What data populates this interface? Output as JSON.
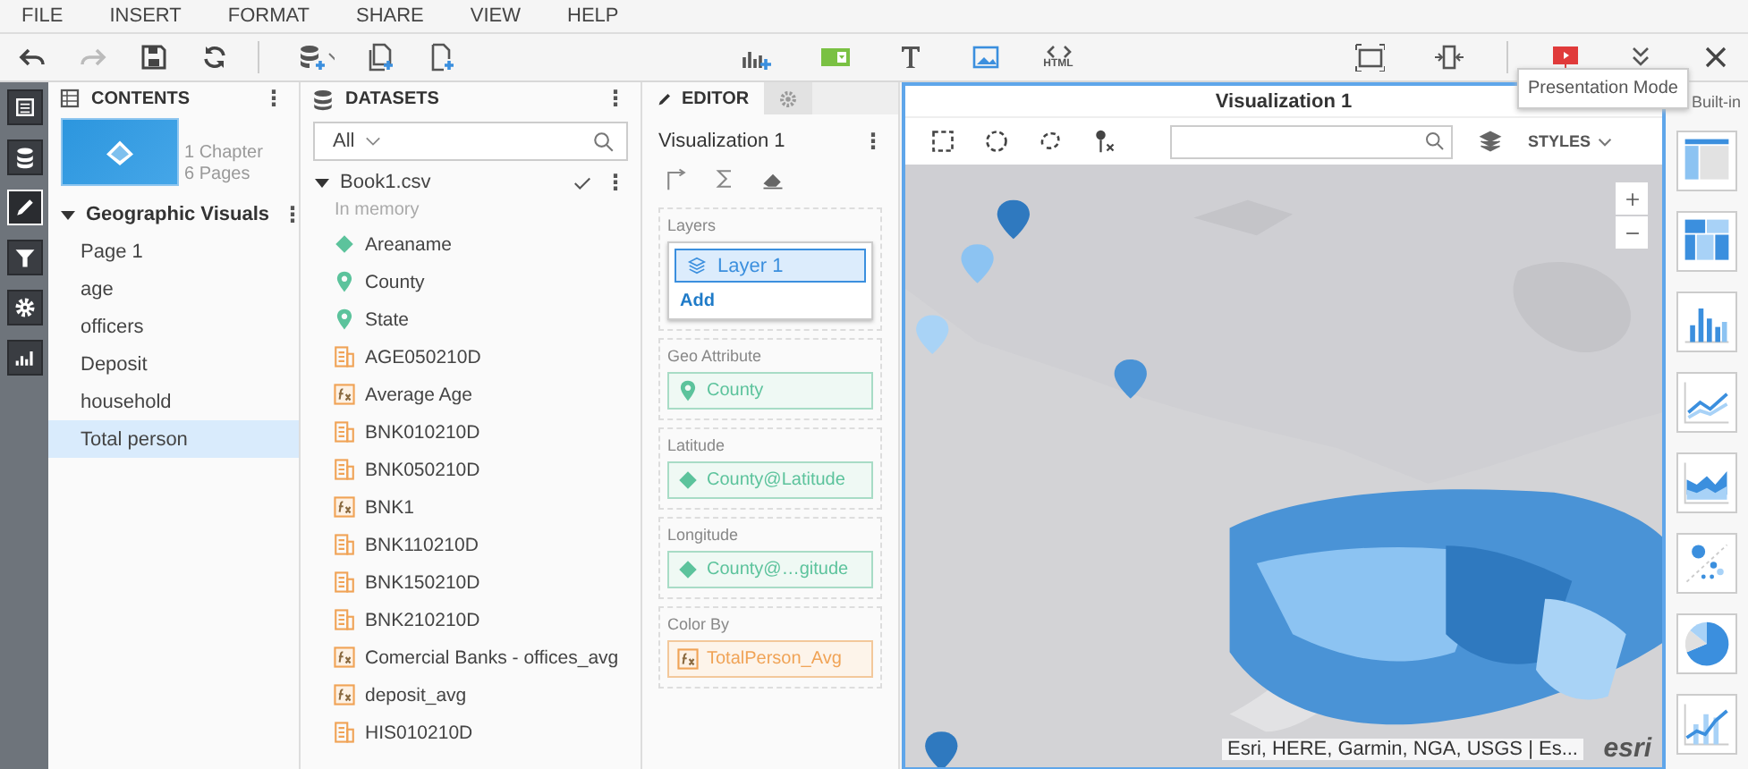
{
  "menu": [
    "FILE",
    "INSERT",
    "FORMAT",
    "SHARE",
    "VIEW",
    "HELP"
  ],
  "toolbar": {
    "html_label": "HTML",
    "tooltip": "Presentation Mode"
  },
  "rail": [
    {
      "kind": "contents",
      "selected": false
    },
    {
      "kind": "datasets",
      "selected": false
    },
    {
      "kind": "editor",
      "selected": true
    },
    {
      "kind": "filter",
      "selected": false
    },
    {
      "kind": "settings",
      "selected": false
    },
    {
      "kind": "charts",
      "selected": false
    }
  ],
  "contents": {
    "title": "CONTENTS",
    "more": "⋮",
    "chapters": "1 Chapter",
    "pages": "6 Pages",
    "chapter": {
      "title": "Geographic Visuals",
      "more": "⋮",
      "expanded": true,
      "children": [
        {
          "label": "Page 1",
          "selected": false
        },
        {
          "label": "age",
          "selected": false
        },
        {
          "label": "officers",
          "selected": false
        },
        {
          "label": "Deposit",
          "selected": false
        },
        {
          "label": "household",
          "selected": false
        },
        {
          "label": "Total person",
          "selected": true
        }
      ]
    }
  },
  "datasets": {
    "title": "DATASETS",
    "more": "⋮",
    "filter": "All",
    "dataset": {
      "name": "Book1.csv",
      "more": "⋮",
      "expanded": true,
      "status": "In memory",
      "fields": [
        {
          "kind": "attribute",
          "label": "Areaname"
        },
        {
          "kind": "geo",
          "label": "County"
        },
        {
          "kind": "geo",
          "label": "State"
        },
        {
          "kind": "metric",
          "label": "AGE050210D"
        },
        {
          "kind": "derived",
          "label": "Average Age"
        },
        {
          "kind": "metric",
          "label": "BNK010210D"
        },
        {
          "kind": "metric",
          "label": "BNK050210D"
        },
        {
          "kind": "derived",
          "label": "BNK1"
        },
        {
          "kind": "metric",
          "label": "BNK110210D"
        },
        {
          "kind": "metric",
          "label": "BNK150210D"
        },
        {
          "kind": "metric",
          "label": "BNK210210D"
        },
        {
          "kind": "derived",
          "label": "Comercial Banks - offices_avg"
        },
        {
          "kind": "derived",
          "label": "deposit_avg"
        },
        {
          "kind": "metric",
          "label": "HIS010210D"
        }
      ]
    }
  },
  "editor": {
    "tabs": [
      {
        "kind": "editor",
        "label": "EDITOR",
        "selected": true
      },
      {
        "kind": "settings",
        "selected": false
      }
    ],
    "title": "Visualization 1",
    "more": "⋮",
    "sections": [
      {
        "kind": "layers",
        "label": "Layers",
        "layers": [
          {
            "label": "Layer 1",
            "selected": true
          }
        ],
        "add": "Add"
      },
      {
        "kind": "geo",
        "label": "Geo Attribute",
        "value": "County"
      },
      {
        "kind": "attribute",
        "label": "Latitude",
        "value": "County@Latitude"
      },
      {
        "kind": "attribute",
        "label": "Longitude",
        "value": "County@…gitude"
      },
      {
        "kind": "derived",
        "label": "Color By",
        "value": "TotalPerson_Avg"
      }
    ]
  },
  "visualization": {
    "title": "Visualization 1",
    "styles": "STYLES",
    "attribution": "Esri, HERE, Garmin, NGA, USGS | Es...",
    "logo": "esri"
  },
  "gallery": {
    "title": "Built-in",
    "items": [
      {
        "kind": "grid"
      },
      {
        "kind": "heatmap"
      },
      {
        "kind": "bar"
      },
      {
        "kind": "line"
      },
      {
        "kind": "area"
      },
      {
        "kind": "scatter"
      },
      {
        "kind": "pie"
      },
      {
        "kind": "combo"
      }
    ]
  }
}
